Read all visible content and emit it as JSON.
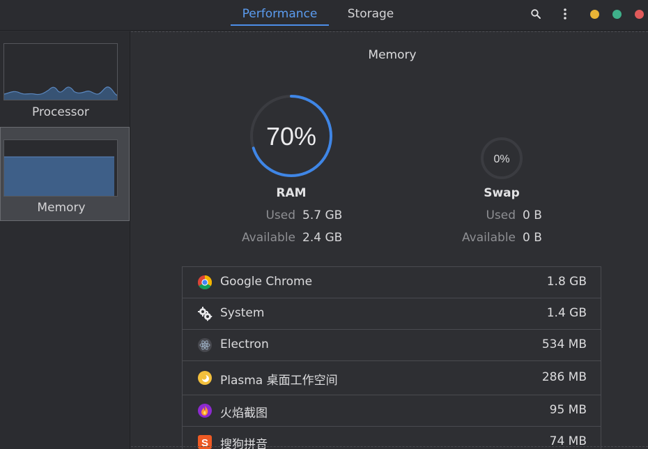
{
  "header": {
    "tabs": [
      {
        "label": "Performance",
        "active": true
      },
      {
        "label": "Storage",
        "active": false
      }
    ],
    "icons": [
      "search-icon",
      "kebab-menu-icon"
    ],
    "window_controls": [
      {
        "name": "minimize",
        "color": "#e8b436"
      },
      {
        "name": "maximize",
        "color": "#3fb08a"
      },
      {
        "name": "close",
        "color": "#e05a5a"
      }
    ]
  },
  "sidebar": {
    "items": [
      {
        "label": "Processor",
        "selected": false
      },
      {
        "label": "Memory",
        "selected": true
      }
    ]
  },
  "main": {
    "title": "Memory",
    "ram": {
      "percent_text": "70%",
      "percent": 70,
      "label": "RAM",
      "used_key": "Used",
      "used_val": "5.7 GB",
      "available_key": "Available",
      "available_val": "2.4 GB",
      "accent": "#3f86e6"
    },
    "swap": {
      "percent_text": "0%",
      "percent": 0,
      "label": "Swap",
      "used_key": "Used",
      "used_val": "0 B",
      "available_key": "Available",
      "available_val": "0 B"
    },
    "processes": [
      {
        "name": "Google Chrome",
        "memory": "1.8 GB",
        "icon": "chrome-icon"
      },
      {
        "name": "System",
        "memory": "1.4 GB",
        "icon": "gears-icon"
      },
      {
        "name": "Electron",
        "memory": "534 MB",
        "icon": "electron-icon"
      },
      {
        "name": "Plasma 桌面工作空间",
        "memory": "286 MB",
        "icon": "plasma-icon"
      },
      {
        "name": "火焰截图",
        "memory": "95 MB",
        "icon": "flameshot-icon"
      },
      {
        "name": "搜狗拼音",
        "memory": "74 MB",
        "icon": "sogou-icon"
      }
    ]
  }
}
